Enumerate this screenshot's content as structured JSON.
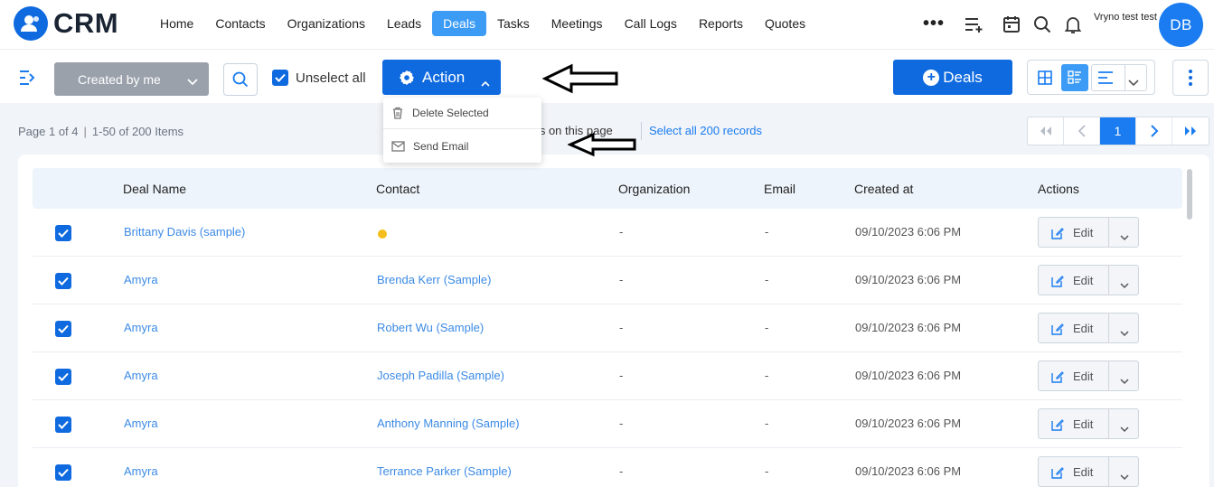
{
  "app": {
    "logo_text": "CRM"
  },
  "nav": {
    "items": [
      "Home",
      "Contacts",
      "Organizations",
      "Leads",
      "Deals",
      "Tasks",
      "Meetings",
      "Call Logs",
      "Reports",
      "Quotes"
    ],
    "active": "Deals",
    "more": "•••"
  },
  "user": {
    "name": "Vryno test test",
    "initials": "DB"
  },
  "toolbar": {
    "filter_label": "Created by me",
    "unselect_label": "Unselect all",
    "action_label": "Action",
    "add_label": "Deals"
  },
  "dropdown": {
    "items": [
      "Delete Selected",
      "Send Email"
    ]
  },
  "pagination": {
    "page_text": "Page 1 of 4",
    "items_text": "1-50 of 200 Items",
    "on_page_text": "ms on this page",
    "select_all_text": "Select all 200 records",
    "current_page": "1"
  },
  "table": {
    "columns": [
      "Deal Name",
      "Contact",
      "Organization",
      "Email",
      "Created at",
      "Actions"
    ],
    "edit_label": "Edit",
    "rows": [
      {
        "deal": "Brittany Davis (sample)",
        "contact": "",
        "org": "-",
        "email": "-",
        "created": "09/10/2023 6:06 PM"
      },
      {
        "deal": "Amyra",
        "contact": "Brenda Kerr (Sample)",
        "org": "-",
        "email": "-",
        "created": "09/10/2023 6:06 PM"
      },
      {
        "deal": "Amyra",
        "contact": "Robert Wu (Sample)",
        "org": "-",
        "email": "-",
        "created": "09/10/2023 6:06 PM"
      },
      {
        "deal": "Amyra",
        "contact": "Joseph Padilla (Sample)",
        "org": "-",
        "email": "-",
        "created": "09/10/2023 6:06 PM"
      },
      {
        "deal": "Amyra",
        "contact": "Anthony Manning (Sample)",
        "org": "-",
        "email": "-",
        "created": "09/10/2023 6:06 PM"
      },
      {
        "deal": "Amyra",
        "contact": "Terrance Parker (Sample)",
        "org": "-",
        "email": "-",
        "created": "09/10/2023 6:06 PM"
      }
    ]
  },
  "colors": {
    "primary": "#0f6ae0",
    "link": "#3b8ae6",
    "warning": "#f4bf1a"
  }
}
